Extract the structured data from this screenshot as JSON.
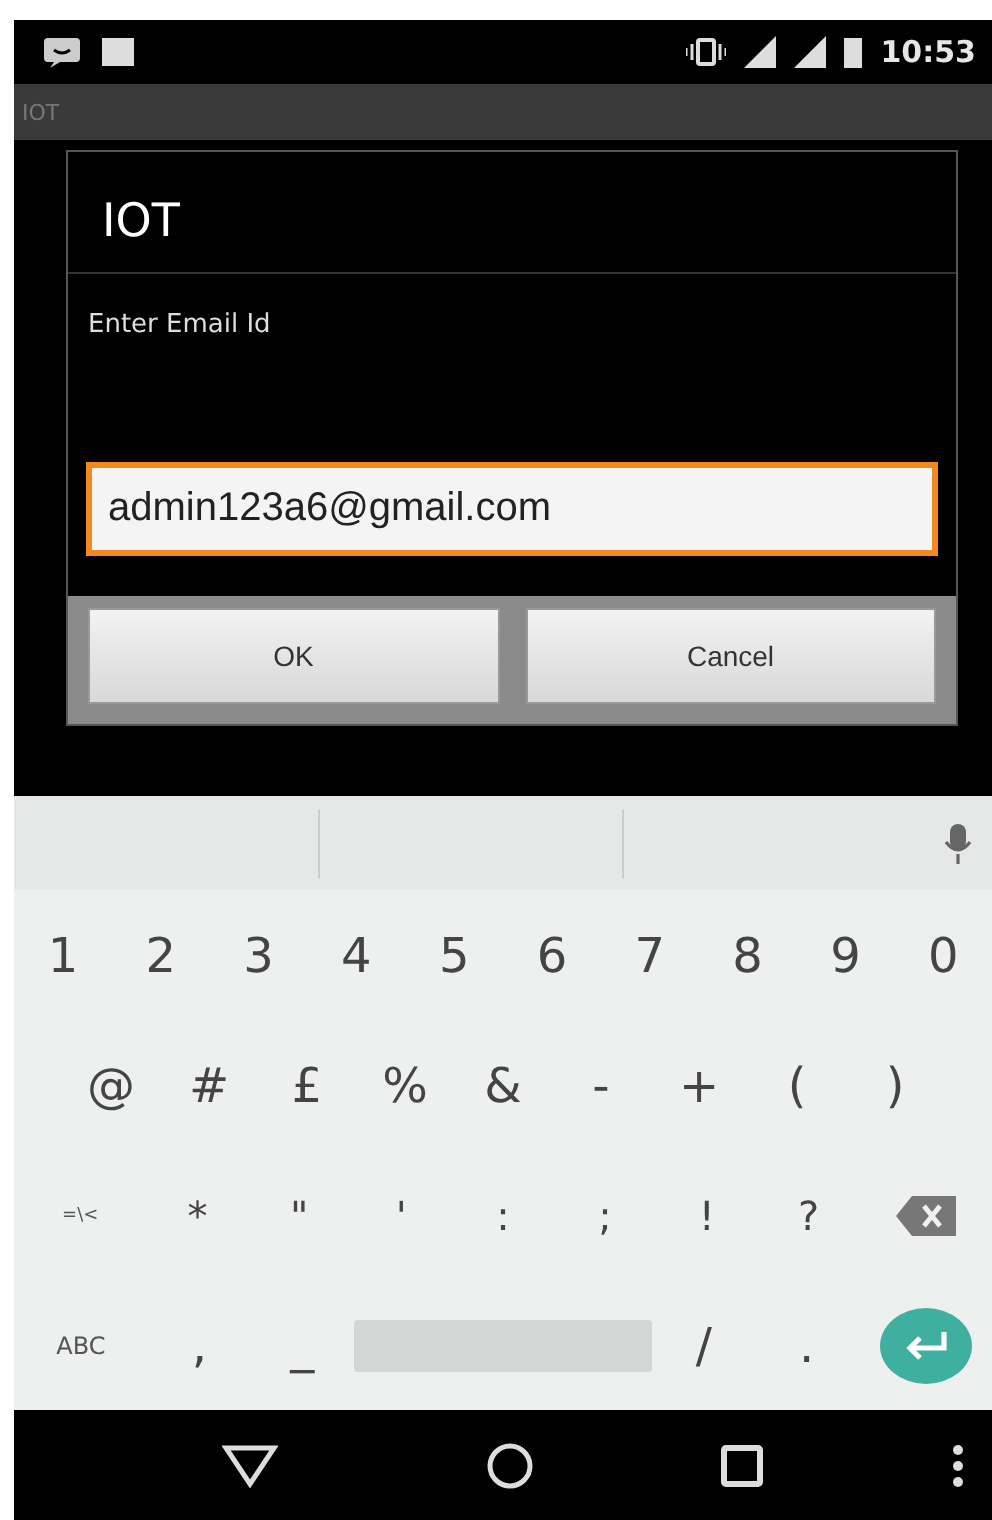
{
  "status_bar": {
    "time": "10:53"
  },
  "app_bar": {
    "title": "IOT"
  },
  "dialog": {
    "title": "IOT",
    "message": "Enter Email Id",
    "field": {
      "value": "admin123a6@gmail.com",
      "focused": true
    },
    "buttons": [
      "OK",
      "Cancel"
    ]
  },
  "keyboard": {
    "rows": [
      {
        "keys": [
          {
            "kind": "char",
            "label": "1"
          },
          {
            "kind": "char",
            "label": "2"
          },
          {
            "kind": "char",
            "label": "3"
          },
          {
            "kind": "char",
            "label": "4"
          },
          {
            "kind": "char",
            "label": "5"
          },
          {
            "kind": "char",
            "label": "6"
          },
          {
            "kind": "char",
            "label": "7"
          },
          {
            "kind": "char",
            "label": "8"
          },
          {
            "kind": "char",
            "label": "9"
          },
          {
            "kind": "char",
            "label": "0"
          }
        ]
      },
      {
        "keys": [
          {
            "kind": "char",
            "label": "@"
          },
          {
            "kind": "char",
            "label": "#"
          },
          {
            "kind": "char",
            "label": "£"
          },
          {
            "kind": "char",
            "label": "%"
          },
          {
            "kind": "char",
            "label": "&"
          },
          {
            "kind": "char",
            "label": "-"
          },
          {
            "kind": "char",
            "label": "+"
          },
          {
            "kind": "char",
            "label": "("
          },
          {
            "kind": "char",
            "label": ")"
          }
        ]
      },
      {
        "keys": [
          {
            "kind": "mode",
            "label": "=\\<"
          },
          {
            "kind": "char",
            "label": "*"
          },
          {
            "kind": "char",
            "label": "\""
          },
          {
            "kind": "char",
            "label": "'"
          },
          {
            "kind": "char",
            "label": ":"
          },
          {
            "kind": "char",
            "label": ";"
          },
          {
            "kind": "char",
            "label": "!"
          },
          {
            "kind": "char",
            "label": "?"
          },
          {
            "kind": "backspace"
          }
        ]
      },
      {
        "keys": [
          {
            "kind": "mode",
            "label": "ABC"
          },
          {
            "kind": "char",
            "label": ","
          },
          {
            "kind": "char",
            "label": "_"
          },
          {
            "kind": "space"
          },
          {
            "kind": "char",
            "label": "/"
          },
          {
            "kind": "char",
            "label": "."
          },
          {
            "kind": "enter"
          }
        ]
      }
    ]
  }
}
